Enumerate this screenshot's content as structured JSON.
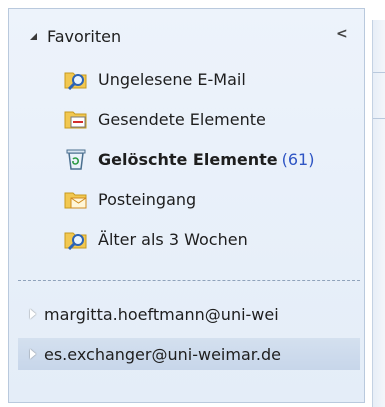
{
  "favorites": {
    "header": "Favoriten",
    "items": [
      {
        "label": "Ungelesene E-Mail",
        "icon": "search-folder-icon",
        "bold": false,
        "count": ""
      },
      {
        "label": "Gesendete Elemente",
        "icon": "sent-items-icon",
        "bold": false,
        "count": ""
      },
      {
        "label": "Gelöschte Elemente",
        "icon": "deleted-items-icon",
        "bold": true,
        "count": "(61)"
      },
      {
        "label": "Posteingang",
        "icon": "inbox-icon",
        "bold": false,
        "count": ""
      },
      {
        "label": "Älter als 3 Wochen",
        "icon": "search-folder-icon",
        "bold": false,
        "count": ""
      }
    ]
  },
  "accounts": [
    {
      "label": "margitta.hoeftmann@uni-wei"
    },
    {
      "label": "es.exchanger@uni-weimar.de"
    }
  ],
  "colors": {
    "count": "#2f55c4",
    "selected_bg": "#c7d6ea",
    "pane_bg": "#e4edf8"
  }
}
